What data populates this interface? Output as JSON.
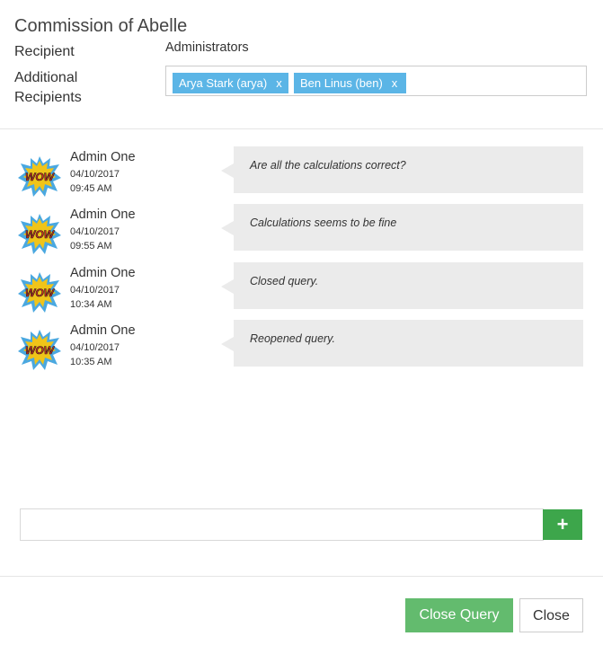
{
  "modal": {
    "title": "Commission of Abelle"
  },
  "recipient": {
    "label": "Recipient",
    "value": "Administrators"
  },
  "additional": {
    "label_line1": "Additional",
    "label_line2": "Recipients",
    "tags": [
      {
        "name": "Arya Stark (arya)",
        "remove": "x"
      },
      {
        "name": "Ben Linus (ben)",
        "remove": "x"
      }
    ]
  },
  "avatar": {
    "text": "WOW"
  },
  "messages": [
    {
      "author": "Admin One",
      "date": "04/10/2017",
      "time": "09:45 AM",
      "text": "Are all the calculations correct?"
    },
    {
      "author": "Admin One",
      "date": "04/10/2017",
      "time": "09:55 AM",
      "text": "Calculations seems to be fine"
    },
    {
      "author": "Admin One",
      "date": "04/10/2017",
      "time": "10:34 AM",
      "text": "Closed query."
    },
    {
      "author": "Admin One",
      "date": "04/10/2017",
      "time": "10:35 AM",
      "text": "Reopened query."
    }
  ],
  "comment": {
    "value": "",
    "add_label": "+"
  },
  "footer": {
    "close_query_label": "Close Query",
    "close_label": "Close"
  }
}
